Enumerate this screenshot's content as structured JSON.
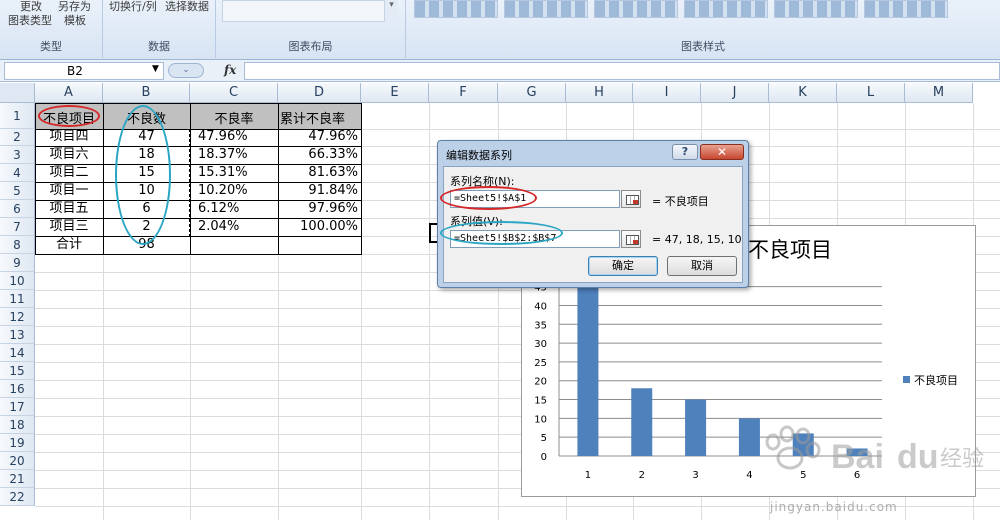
{
  "ribbon": {
    "groups": [
      {
        "label": "类型",
        "buttons": [
          "更改",
          "另存为",
          "图表类型",
          "模板"
        ]
      },
      {
        "label": "数据",
        "buttons": [
          "切换行/列",
          "选择数据"
        ]
      },
      {
        "label": "图表布局",
        "buttons": []
      },
      {
        "label": "图表样式",
        "buttons": []
      }
    ]
  },
  "formula_bar": {
    "name_box": "B2",
    "fx": "fx",
    "formula": ""
  },
  "sheet": {
    "columns": [
      "A",
      "B",
      "C",
      "D",
      "E",
      "F",
      "G",
      "H",
      "I",
      "J",
      "K",
      "L",
      "M"
    ],
    "rows": [
      "1",
      "2",
      "3",
      "4",
      "5",
      "6",
      "7",
      "8",
      "9",
      "10",
      "11",
      "12",
      "13",
      "14",
      "15",
      "16",
      "17",
      "18",
      "19",
      "20",
      "21",
      "22"
    ],
    "header": [
      "不良项目",
      "不良数",
      "不良率",
      "累计不良率"
    ],
    "data": [
      [
        "项目四",
        "47",
        "47.96%",
        "47.96%"
      ],
      [
        "项目六",
        "18",
        "18.37%",
        "66.33%"
      ],
      [
        "项目二",
        "15",
        "15.31%",
        "81.63%"
      ],
      [
        "项目一",
        "10",
        "10.20%",
        "91.84%"
      ],
      [
        "项目五",
        "6",
        "6.12%",
        "97.96%"
      ],
      [
        "项目三",
        "2",
        "2.04%",
        "100.00%"
      ]
    ],
    "total_label": "合计",
    "total_value": "98"
  },
  "dialog": {
    "title": "编辑数据系列",
    "help": "?",
    "close": "✕",
    "name_label": "系列名称(N):",
    "name_value": "=Sheet5!$A$1",
    "name_preview": "= 不良项目",
    "values_label": "系列值(V):",
    "values_value": "=Sheet5!$B$2:$B$7",
    "values_preview": "= 47, 18, 15, 10...",
    "ok": "确定",
    "cancel": "取消"
  },
  "chart_data": {
    "type": "bar",
    "title": "不良项目",
    "categories": [
      "1",
      "2",
      "3",
      "4",
      "5",
      "6"
    ],
    "series": [
      {
        "name": "不良项目",
        "values": [
          47,
          18,
          15,
          10,
          6,
          2
        ]
      }
    ],
    "yticks": [
      "0",
      "5",
      "10",
      "15",
      "20",
      "25",
      "30",
      "35",
      "40",
      "45"
    ],
    "ylim": [
      0,
      50
    ],
    "grid": true,
    "legend": "right",
    "bar_color": "#4f81bd"
  },
  "watermark": {
    "brand": "Bai du 经验",
    "url": "jingyan.baidu.com"
  },
  "colors": {
    "red_ellipse": "#d62828",
    "blue_ellipse": "#2aa6c4"
  }
}
